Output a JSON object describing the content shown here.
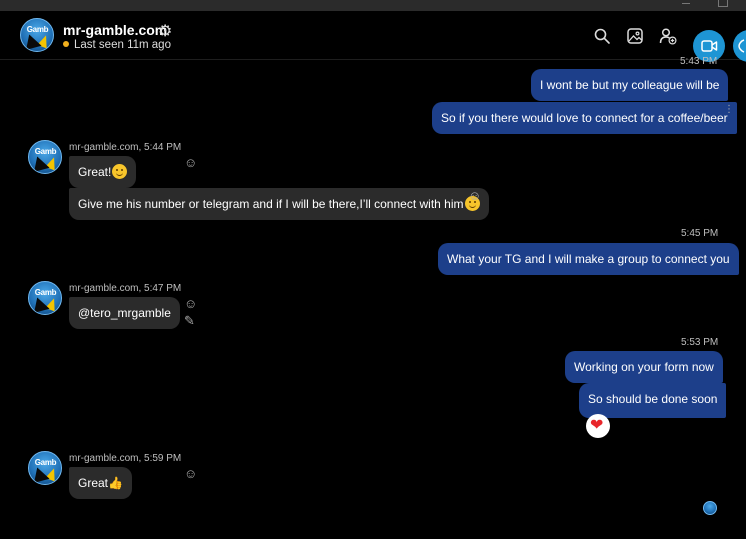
{
  "header": {
    "contact_name": "mr-gamble.com",
    "status": "Last seen 11m ago",
    "status_color": "#f2b01e",
    "icons": [
      "settings-icon",
      "search-icon",
      "gallery-icon",
      "add-person-icon",
      "video-call-icon",
      "call-icon"
    ]
  },
  "messages": [
    {
      "dir": "out",
      "text": "I wont be but my colleague will be",
      "time": "5:43 PM"
    },
    {
      "dir": "out",
      "text": "So if you there would love to connect for a coffee/beer"
    },
    {
      "dir": "in",
      "sender": "mr-gamble.com, 5:44 PM",
      "text": "Great!"
    },
    {
      "dir": "in",
      "text": "Give me his number or telegram and if I will be there,I’ll connect with him"
    },
    {
      "dir": "out",
      "text": "What your TG and I will make a group to connect you",
      "time": "5:45 PM"
    },
    {
      "dir": "in",
      "sender": "mr-gamble.com, 5:47 PM",
      "text": "@tero_mrgamble"
    },
    {
      "dir": "out",
      "text": "Working on your form now",
      "time": "5:53 PM"
    },
    {
      "dir": "out",
      "text": "So should be done soon",
      "reaction": "heart"
    },
    {
      "dir": "in",
      "sender": "mr-gamble.com, 5:59 PM",
      "text": "Great"
    }
  ],
  "labels": {
    "time_543": "5:43 PM",
    "time_545": "5:45 PM",
    "time_553": "5:53 PM",
    "sender_544": "mr-gamble.com, 5:44 PM",
    "sender_547": "mr-gamble.com, 5:47 PM",
    "sender_559": "mr-gamble.com, 5:59 PM",
    "avatar_text": "Gamb"
  },
  "colors": {
    "outgoing_bubble": "#1d3f8a",
    "incoming_bubble": "#2b2b2b",
    "accent_button": "#1e95d4"
  }
}
